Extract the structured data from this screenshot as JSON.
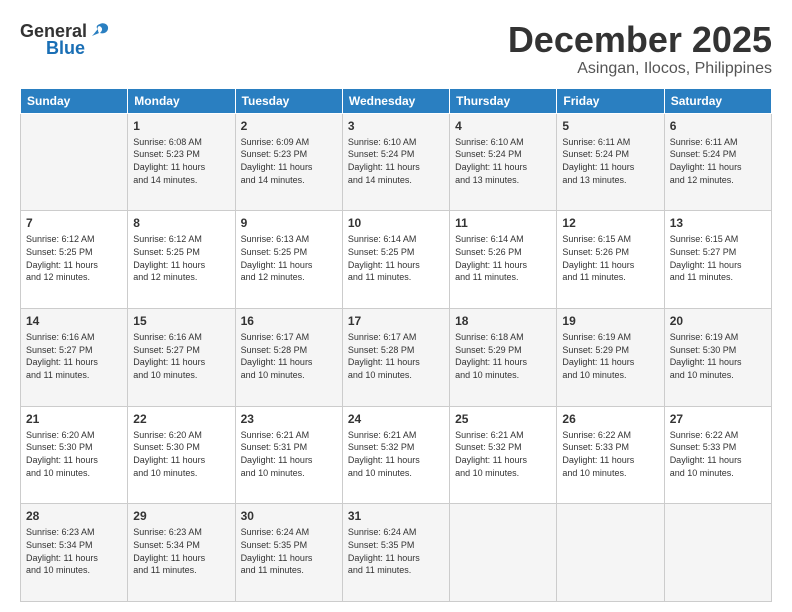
{
  "header": {
    "logo": {
      "text_general": "General",
      "text_blue": "Blue"
    },
    "month": "December 2025",
    "location": "Asingan, Ilocos, Philippines"
  },
  "days_of_week": [
    "Sunday",
    "Monday",
    "Tuesday",
    "Wednesday",
    "Thursday",
    "Friday",
    "Saturday"
  ],
  "weeks": [
    [
      {
        "day": "",
        "info": ""
      },
      {
        "day": "1",
        "info": "Sunrise: 6:08 AM\nSunset: 5:23 PM\nDaylight: 11 hours\nand 14 minutes."
      },
      {
        "day": "2",
        "info": "Sunrise: 6:09 AM\nSunset: 5:23 PM\nDaylight: 11 hours\nand 14 minutes."
      },
      {
        "day": "3",
        "info": "Sunrise: 6:10 AM\nSunset: 5:24 PM\nDaylight: 11 hours\nand 14 minutes."
      },
      {
        "day": "4",
        "info": "Sunrise: 6:10 AM\nSunset: 5:24 PM\nDaylight: 11 hours\nand 13 minutes."
      },
      {
        "day": "5",
        "info": "Sunrise: 6:11 AM\nSunset: 5:24 PM\nDaylight: 11 hours\nand 13 minutes."
      },
      {
        "day": "6",
        "info": "Sunrise: 6:11 AM\nSunset: 5:24 PM\nDaylight: 11 hours\nand 12 minutes."
      }
    ],
    [
      {
        "day": "7",
        "info": "Sunrise: 6:12 AM\nSunset: 5:25 PM\nDaylight: 11 hours\nand 12 minutes."
      },
      {
        "day": "8",
        "info": "Sunrise: 6:12 AM\nSunset: 5:25 PM\nDaylight: 11 hours\nand 12 minutes."
      },
      {
        "day": "9",
        "info": "Sunrise: 6:13 AM\nSunset: 5:25 PM\nDaylight: 11 hours\nand 12 minutes."
      },
      {
        "day": "10",
        "info": "Sunrise: 6:14 AM\nSunset: 5:25 PM\nDaylight: 11 hours\nand 11 minutes."
      },
      {
        "day": "11",
        "info": "Sunrise: 6:14 AM\nSunset: 5:26 PM\nDaylight: 11 hours\nand 11 minutes."
      },
      {
        "day": "12",
        "info": "Sunrise: 6:15 AM\nSunset: 5:26 PM\nDaylight: 11 hours\nand 11 minutes."
      },
      {
        "day": "13",
        "info": "Sunrise: 6:15 AM\nSunset: 5:27 PM\nDaylight: 11 hours\nand 11 minutes."
      }
    ],
    [
      {
        "day": "14",
        "info": "Sunrise: 6:16 AM\nSunset: 5:27 PM\nDaylight: 11 hours\nand 11 minutes."
      },
      {
        "day": "15",
        "info": "Sunrise: 6:16 AM\nSunset: 5:27 PM\nDaylight: 11 hours\nand 10 minutes."
      },
      {
        "day": "16",
        "info": "Sunrise: 6:17 AM\nSunset: 5:28 PM\nDaylight: 11 hours\nand 10 minutes."
      },
      {
        "day": "17",
        "info": "Sunrise: 6:17 AM\nSunset: 5:28 PM\nDaylight: 11 hours\nand 10 minutes."
      },
      {
        "day": "18",
        "info": "Sunrise: 6:18 AM\nSunset: 5:29 PM\nDaylight: 11 hours\nand 10 minutes."
      },
      {
        "day": "19",
        "info": "Sunrise: 6:19 AM\nSunset: 5:29 PM\nDaylight: 11 hours\nand 10 minutes."
      },
      {
        "day": "20",
        "info": "Sunrise: 6:19 AM\nSunset: 5:30 PM\nDaylight: 11 hours\nand 10 minutes."
      }
    ],
    [
      {
        "day": "21",
        "info": "Sunrise: 6:20 AM\nSunset: 5:30 PM\nDaylight: 11 hours\nand 10 minutes."
      },
      {
        "day": "22",
        "info": "Sunrise: 6:20 AM\nSunset: 5:30 PM\nDaylight: 11 hours\nand 10 minutes."
      },
      {
        "day": "23",
        "info": "Sunrise: 6:21 AM\nSunset: 5:31 PM\nDaylight: 11 hours\nand 10 minutes."
      },
      {
        "day": "24",
        "info": "Sunrise: 6:21 AM\nSunset: 5:32 PM\nDaylight: 11 hours\nand 10 minutes."
      },
      {
        "day": "25",
        "info": "Sunrise: 6:21 AM\nSunset: 5:32 PM\nDaylight: 11 hours\nand 10 minutes."
      },
      {
        "day": "26",
        "info": "Sunrise: 6:22 AM\nSunset: 5:33 PM\nDaylight: 11 hours\nand 10 minutes."
      },
      {
        "day": "27",
        "info": "Sunrise: 6:22 AM\nSunset: 5:33 PM\nDaylight: 11 hours\nand 10 minutes."
      }
    ],
    [
      {
        "day": "28",
        "info": "Sunrise: 6:23 AM\nSunset: 5:34 PM\nDaylight: 11 hours\nand 10 minutes."
      },
      {
        "day": "29",
        "info": "Sunrise: 6:23 AM\nSunset: 5:34 PM\nDaylight: 11 hours\nand 11 minutes."
      },
      {
        "day": "30",
        "info": "Sunrise: 6:24 AM\nSunset: 5:35 PM\nDaylight: 11 hours\nand 11 minutes."
      },
      {
        "day": "31",
        "info": "Sunrise: 6:24 AM\nSunset: 5:35 PM\nDaylight: 11 hours\nand 11 minutes."
      },
      {
        "day": "",
        "info": ""
      },
      {
        "day": "",
        "info": ""
      },
      {
        "day": "",
        "info": ""
      }
    ]
  ]
}
